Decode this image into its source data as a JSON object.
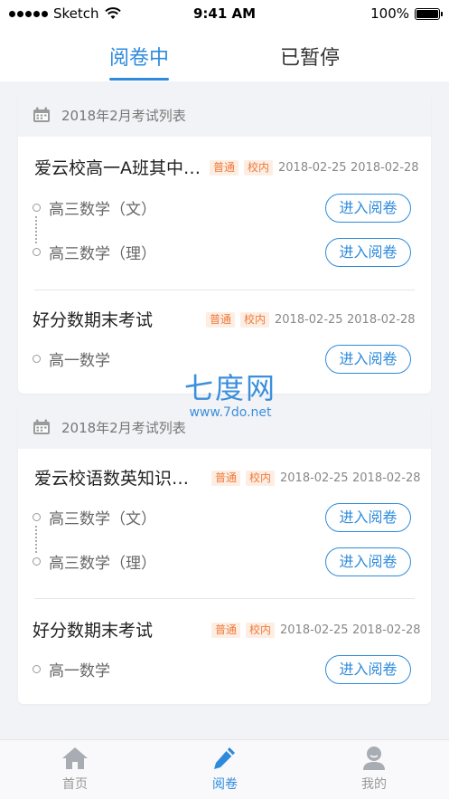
{
  "status_bar": {
    "carrier": "Sketch",
    "time": "9:41 AM",
    "battery": "100%"
  },
  "tabs": [
    {
      "label": "阅卷中",
      "active": true
    },
    {
      "label": "已暂停",
      "active": false
    }
  ],
  "accent_color": "#2e8bdc",
  "tag_color": "#f07a3a",
  "cards": [
    {
      "header": "2018年2月考试列表",
      "exams": [
        {
          "title": "爱云校高一A班其中…",
          "tags": [
            "普通",
            "校内"
          ],
          "start_date": "2018-02-25",
          "end_date": "2018-02-28",
          "subjects": [
            {
              "name": "高三数学（文）",
              "button": "进入阅卷"
            },
            {
              "name": "高三数学（理）",
              "button": "进入阅卷"
            }
          ]
        },
        {
          "title": "好分数期末考试",
          "tags": [
            "普通",
            "校内"
          ],
          "start_date": "2018-02-25",
          "end_date": "2018-02-28",
          "subjects": [
            {
              "name": "高一数学",
              "button": "进入阅卷"
            }
          ]
        }
      ]
    },
    {
      "header": "2018年2月考试列表",
      "exams": [
        {
          "title": "爱云校语数英知识…",
          "tags": [
            "普通",
            "校内"
          ],
          "start_date": "2018-02-25",
          "end_date": "2018-02-28",
          "subjects": [
            {
              "name": "高三数学（文）",
              "button": "进入阅卷"
            },
            {
              "name": "高三数学（理）",
              "button": "进入阅卷"
            }
          ]
        },
        {
          "title": "好分数期末考试",
          "tags": [
            "普通",
            "校内"
          ],
          "start_date": "2018-02-25",
          "end_date": "2018-02-28",
          "subjects": [
            {
              "name": "高一数学",
              "button": "进入阅卷"
            }
          ]
        }
      ]
    }
  ],
  "watermark": {
    "brand": "七度网",
    "url": "www.7do.net"
  },
  "bottom_nav": [
    {
      "label": "首页",
      "icon": "home-icon",
      "active": false
    },
    {
      "label": "阅卷",
      "icon": "pencil-icon",
      "active": true
    },
    {
      "label": "我的",
      "icon": "user-icon",
      "active": false
    }
  ]
}
